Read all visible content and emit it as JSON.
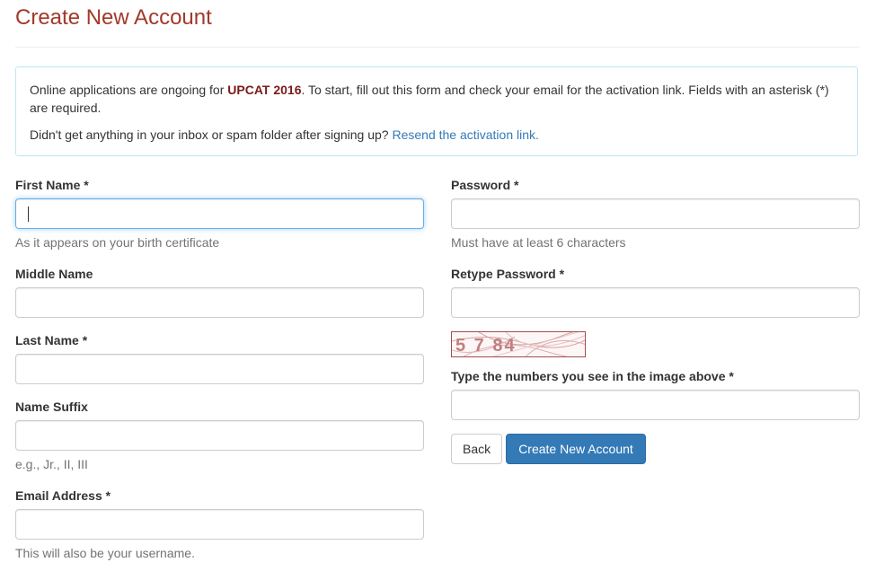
{
  "page": {
    "title": "Create New Account"
  },
  "alert": {
    "text_before": "Online applications are ongoing for ",
    "highlight": "UPCAT 2016",
    "text_after": ". To start, fill out this form and check your email for the activation link. Fields with an asterisk (*) are required.",
    "resend_prompt": "Didn't get anything in your inbox or spam folder after signing up? ",
    "resend_link": "Resend the activation link."
  },
  "form": {
    "first_name": {
      "label": "First Name *",
      "value": "",
      "help": "As it appears on your birth certificate"
    },
    "middle_name": {
      "label": "Middle Name",
      "value": ""
    },
    "last_name": {
      "label": "Last Name *",
      "value": ""
    },
    "name_suffix": {
      "label": "Name Suffix",
      "value": "",
      "help": "e.g., Jr., II, III"
    },
    "email": {
      "label": "Email Address *",
      "value": "",
      "help": "This will also be your username."
    },
    "password": {
      "label": "Password *",
      "value": "",
      "help": "Must have at least 6 characters"
    },
    "retype_password": {
      "label": "Retype Password *",
      "value": ""
    },
    "captcha": {
      "image_text": "5 7 84",
      "label": "Type the numbers you see in the image above *",
      "value": ""
    }
  },
  "buttons": {
    "back": "Back",
    "create": "Create New Account"
  }
}
